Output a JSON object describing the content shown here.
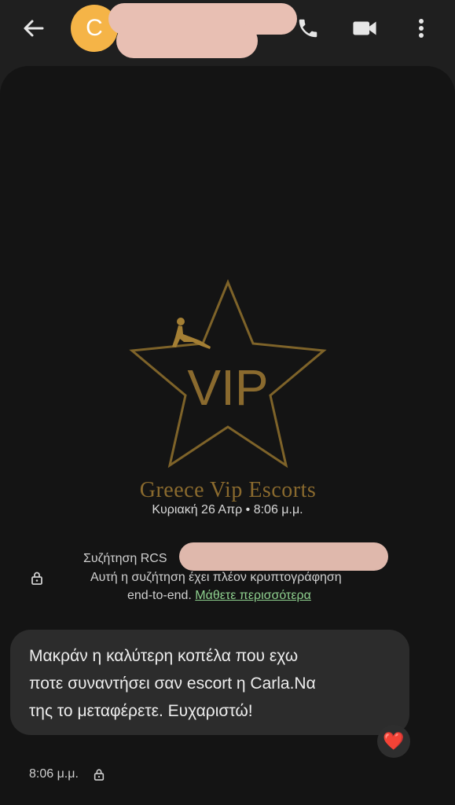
{
  "header": {
    "avatar_letter": "C",
    "icons": [
      "back-arrow-icon",
      "phone-icon",
      "video-call-icon",
      "more-vert-icon"
    ]
  },
  "conversation": {
    "logo": {
      "center_text": "VIP",
      "brand_text": "Greece Vip Escorts"
    },
    "date_stamp": "Κυριακή 26 Απρ • 8:06 μ.μ.",
    "rcs_notice": {
      "line1": "Συζήτηση RCS",
      "line2": "Αυτή η συζήτηση έχει πλέον κρυπτογράφηση",
      "line3": "end-to-end.",
      "learn_more": "Μάθετε περισσότερα"
    },
    "message": {
      "line1": "Μακράν η καλύτερη κοπέλα που εχω",
      "line2": "ποτε συναντήσει σαν escort η Carla.Να",
      "line3": "της το μεταφέρετε. Ευχαριστώ!",
      "reaction": "❤️",
      "time": "8:06 μ.μ."
    }
  },
  "colors": {
    "avatar": "#f5b447",
    "gold": "#8a6a2e",
    "link": "#8fd18f",
    "redaction": "#e8bfb3"
  }
}
